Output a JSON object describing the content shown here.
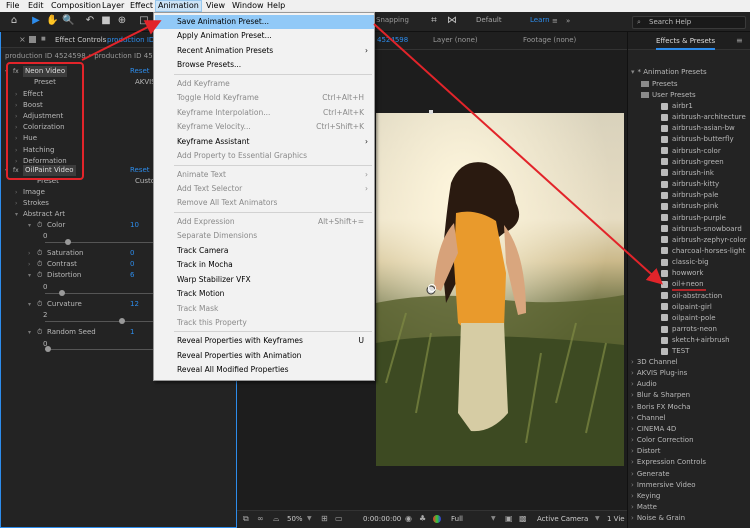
{
  "menubar": {
    "items": [
      "File",
      "Edit",
      "Composition",
      "Layer",
      "Effect",
      "Animation",
      "View",
      "Window",
      "Help"
    ],
    "active": "Animation"
  },
  "toolbar": {
    "snapping_label": "Snapping",
    "workspaces": [
      "Default",
      "Learn"
    ],
    "search_placeholder": "Search Help"
  },
  "left_panel": {
    "tab_label": "Effect Controls",
    "tab_layer": "production ID 4",
    "breadcrumb": "production ID 4524598 • production ID 4524598",
    "effects": [
      {
        "name": "Neon Video",
        "reset": "Reset",
        "preset_label": "Preset",
        "preset_value": "AKVIS"
      },
      {
        "name": "OilPaint Video",
        "reset": "Reset",
        "preset_label": "Preset",
        "preset_value": "Custo"
      }
    ],
    "neon_groups": [
      "Effect",
      "Boost",
      "Adjustment",
      "Colorization",
      "Hue",
      "Hatching",
      "Deformation"
    ],
    "oil_groups": [
      "Image",
      "Strokes",
      "Abstract Art"
    ],
    "params": [
      {
        "name": "Color",
        "value": "10",
        "sub": "0"
      },
      {
        "name": "Saturation",
        "value": "0"
      },
      {
        "name": "Contrast",
        "value": "0"
      },
      {
        "name": "Distortion",
        "value": "6",
        "sub": "0"
      },
      {
        "name": "Curvature",
        "value": "12",
        "sub": "2"
      },
      {
        "name": "Random Seed",
        "value": "1",
        "sub": "0"
      }
    ]
  },
  "middle": {
    "comp_tab_id": "4524598",
    "layer_tab": "Layer (none)",
    "footage_tab": "Footage (none)",
    "zoom": "50%",
    "timecode": "0:00:00:00",
    "resolution": "Full",
    "camera": "Active Camera",
    "views": "1 Vie"
  },
  "right_panel": {
    "tab_label": "Effects & Presets",
    "tree": [
      {
        "label": "* Animation Presets",
        "kind": "root"
      },
      {
        "label": "Presets",
        "kind": "folder"
      },
      {
        "label": "User Presets",
        "kind": "folder"
      }
    ],
    "presets": [
      "airbr1",
      "airbrush-architecture",
      "airbrush-asian-bw",
      "airbrush-butterfly",
      "airbrush-color",
      "airbrush-green",
      "airbrush-ink",
      "airbrush-kitty",
      "airbrush-pale",
      "airbrush-pink",
      "airbrush-purple",
      "airbrush-snowboard",
      "airbrush-zephyr-color",
      "charcoal-horses-light",
      "classic-big",
      "howwork",
      "oil+neon",
      "oil-abstraction",
      "oilpaint-girl",
      "oilpaint-pole",
      "parrots-neon",
      "sketch+airbrush",
      "TEST"
    ],
    "categories": [
      "3D Channel",
      "AKVIS Plug-ins",
      "Audio",
      "Blur & Sharpen",
      "Boris FX Mocha",
      "Channel",
      "CINEMA 4D",
      "Color Correction",
      "Distort",
      "Expression Controls",
      "Generate",
      "Immersive Video",
      "Keying",
      "Matte",
      "Noise & Grain"
    ]
  },
  "animation_menu": {
    "groups": [
      [
        {
          "label": "Save Animation Preset...",
          "enabled": true,
          "highlighted": true
        },
        {
          "label": "Apply Animation Preset...",
          "enabled": true
        },
        {
          "label": "Recent Animation Presets",
          "enabled": true,
          "submenu": true
        },
        {
          "label": "Browse Presets...",
          "enabled": true
        }
      ],
      [
        {
          "label": "Add Keyframe",
          "enabled": false
        },
        {
          "label": "Toggle Hold Keyframe",
          "enabled": false,
          "shortcut": "Ctrl+Alt+H"
        },
        {
          "label": "Keyframe Interpolation...",
          "enabled": false,
          "shortcut": "Ctrl+Alt+K"
        },
        {
          "label": "Keyframe Velocity...",
          "enabled": false,
          "shortcut": "Ctrl+Shift+K"
        },
        {
          "label": "Keyframe Assistant",
          "enabled": true,
          "submenu": true
        },
        {
          "label": "Add Property to Essential Graphics",
          "enabled": false
        }
      ],
      [
        {
          "label": "Animate Text",
          "enabled": false,
          "submenu": true
        },
        {
          "label": "Add Text Selector",
          "enabled": false,
          "submenu": true
        },
        {
          "label": "Remove All Text Animators",
          "enabled": false
        }
      ],
      [
        {
          "label": "Add Expression",
          "enabled": false,
          "shortcut": "Alt+Shift+="
        },
        {
          "label": "Separate Dimensions",
          "enabled": false
        },
        {
          "label": "Track Camera",
          "enabled": true
        },
        {
          "label": "Track in Mocha",
          "enabled": true
        },
        {
          "label": "Warp Stabilizer VFX",
          "enabled": true
        },
        {
          "label": "Track Motion",
          "enabled": true
        },
        {
          "label": "Track Mask",
          "enabled": false
        },
        {
          "label": "Track this Property",
          "enabled": false
        }
      ],
      [
        {
          "label": "Reveal Properties with Keyframes",
          "enabled": true,
          "shortcut": "U"
        },
        {
          "label": "Reveal Properties with Animation",
          "enabled": true
        },
        {
          "label": "Reveal All Modified Properties",
          "enabled": true
        }
      ]
    ]
  },
  "colors": {
    "accent_blue": "#2d8ceb",
    "annotation_red": "#e2242a",
    "menu_highlight": "#91c9f7"
  }
}
